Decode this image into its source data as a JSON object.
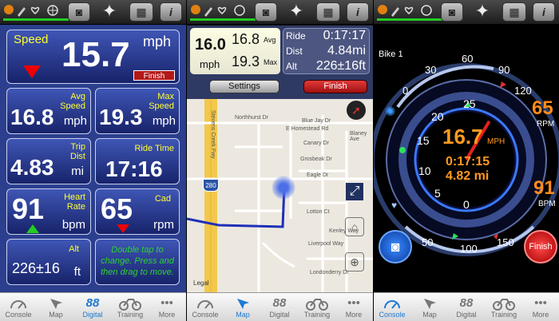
{
  "icons": {
    "status": "status-icons",
    "camera": "camera-icon",
    "person": "person-icon",
    "layout": "layout-icon",
    "info": "info-icon"
  },
  "tabs": [
    {
      "label": "Console",
      "icon": "speedometer-icon"
    },
    {
      "label": "Map",
      "icon": "compass-icon"
    },
    {
      "label": "Digital",
      "icon": "digits-icon",
      "glyph": "88"
    },
    {
      "label": "Training",
      "icon": "bike-icon"
    },
    {
      "label": "More",
      "icon": "more-icon",
      "glyph": "•••"
    }
  ],
  "digital": {
    "speed": {
      "label": "Speed",
      "value": "15.7",
      "unit": "mph",
      "button": "Finish"
    },
    "avg": {
      "label": "Avg\nSpeed",
      "value": "16.8",
      "unit": "mph"
    },
    "max": {
      "label": "Max\nSpeed",
      "value": "19.3",
      "unit": "mph"
    },
    "trip": {
      "label": "Trip\nDist",
      "value": "4.83",
      "unit": "mi"
    },
    "ride": {
      "label": "Ride Time",
      "value": "17:16"
    },
    "hr": {
      "label": "Heart\nRate",
      "value": "91",
      "unit": "bpm"
    },
    "cad": {
      "label": "Cad",
      "value": "65",
      "unit": "rpm"
    },
    "alt": {
      "label": "Alt",
      "value": "226±16",
      "unit": "ft"
    },
    "hint": "Double tap to change. Press and then drag to move."
  },
  "map": {
    "speed": "16.0",
    "speed_unit": "mph",
    "avg": "16.8",
    "avg_label": "Avg",
    "max": "19.3",
    "max_label": "Max",
    "ride_label": "Ride",
    "ride": "0:17:17",
    "dist_label": "Dist",
    "dist": "4.84mi",
    "alt_label": "Alt",
    "alt": "226±16ft",
    "settings": "Settings",
    "finish": "Finish",
    "legal": "Legal",
    "streets": [
      "Northhurst Dr",
      "Blue Jay Dr",
      "Canary Dr",
      "Grosbeak Dr",
      "Eagle Dr",
      "Lotton Ct",
      "Kenley Way",
      "Liverpool Way",
      "Londonderry Dr",
      "E Homestead Rd",
      "Blaney Ave"
    ],
    "shield": "280",
    "road_label": "Stevens Creek Fwy"
  },
  "console": {
    "bike": "Bike 1",
    "speed": "16.7",
    "speed_unit": "MPH",
    "time": "0:17:15",
    "dist": "4.82 mi",
    "cad": "65",
    "cad_unit": "RPM",
    "hr": "91",
    "hr_unit": "BPM",
    "finish": "Finish",
    "ticks": [
      "0",
      "5",
      "10",
      "15",
      "20",
      "25"
    ],
    "outer_ticks": [
      "0",
      "30",
      "60",
      "90",
      "120",
      "150",
      "50",
      "100"
    ],
    "speed_fraction": 0.64
  }
}
